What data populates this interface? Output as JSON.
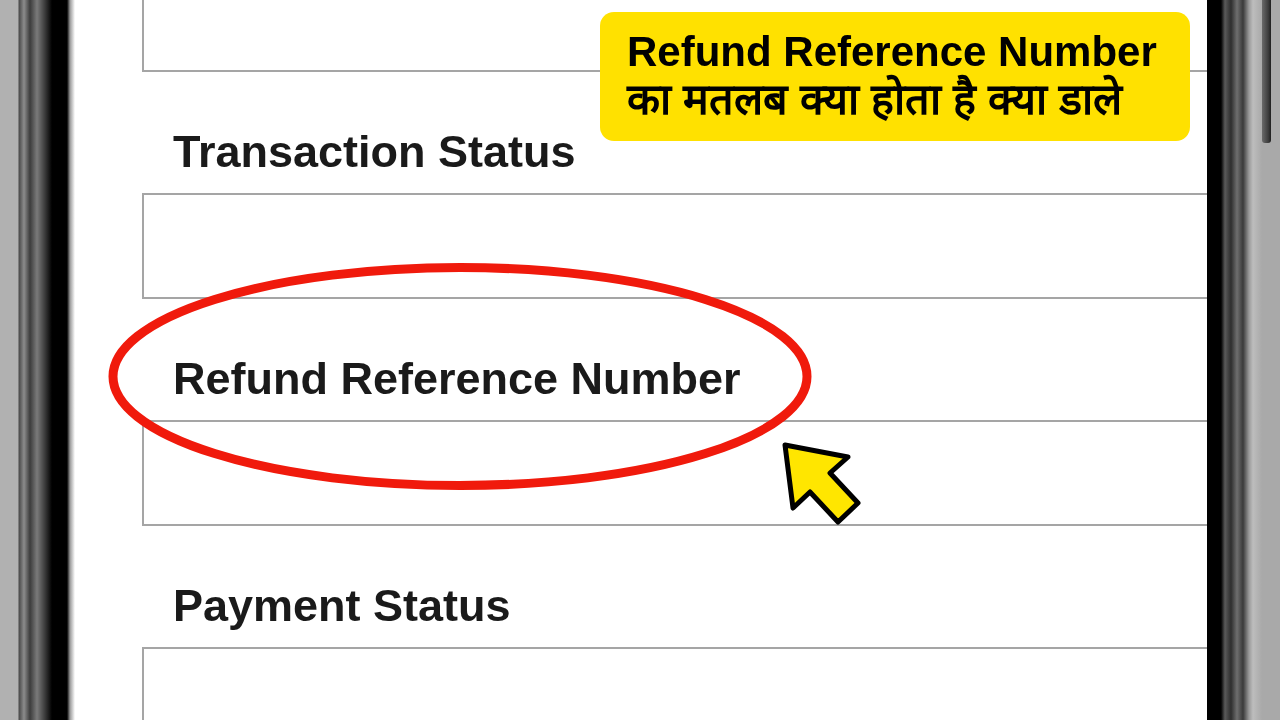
{
  "callout": {
    "title": "Refund Reference Number",
    "subtitle": "का मतलब क्या होता है क्या डाले"
  },
  "form": {
    "items": [
      {
        "kind": "input"
      },
      {
        "kind": "label",
        "text": "Transaction Status",
        "circled": false
      },
      {
        "kind": "input"
      },
      {
        "kind": "label",
        "text": "Refund Reference Number",
        "circled": true
      },
      {
        "kind": "input"
      },
      {
        "kind": "label",
        "text": "Payment Status",
        "circled": false
      },
      {
        "kind": "input"
      }
    ]
  }
}
